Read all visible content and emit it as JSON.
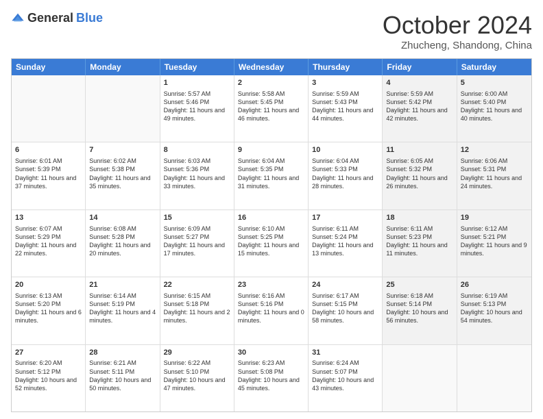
{
  "logo": {
    "general": "General",
    "blue": "Blue"
  },
  "header": {
    "month": "October 2024",
    "location": "Zhucheng, Shandong, China"
  },
  "weekdays": [
    "Sunday",
    "Monday",
    "Tuesday",
    "Wednesday",
    "Thursday",
    "Friday",
    "Saturday"
  ],
  "weeks": [
    [
      {
        "day": "",
        "info": "",
        "shaded": true
      },
      {
        "day": "",
        "info": "",
        "shaded": true
      },
      {
        "day": "1",
        "info": "Sunrise: 5:57 AM\nSunset: 5:46 PM\nDaylight: 11 hours and 49 minutes.",
        "shaded": false
      },
      {
        "day": "2",
        "info": "Sunrise: 5:58 AM\nSunset: 5:45 PM\nDaylight: 11 hours and 46 minutes.",
        "shaded": false
      },
      {
        "day": "3",
        "info": "Sunrise: 5:59 AM\nSunset: 5:43 PM\nDaylight: 11 hours and 44 minutes.",
        "shaded": false
      },
      {
        "day": "4",
        "info": "Sunrise: 5:59 AM\nSunset: 5:42 PM\nDaylight: 11 hours and 42 minutes.",
        "shaded": true
      },
      {
        "day": "5",
        "info": "Sunrise: 6:00 AM\nSunset: 5:40 PM\nDaylight: 11 hours and 40 minutes.",
        "shaded": true
      }
    ],
    [
      {
        "day": "6",
        "info": "Sunrise: 6:01 AM\nSunset: 5:39 PM\nDaylight: 11 hours and 37 minutes.",
        "shaded": false
      },
      {
        "day": "7",
        "info": "Sunrise: 6:02 AM\nSunset: 5:38 PM\nDaylight: 11 hours and 35 minutes.",
        "shaded": false
      },
      {
        "day": "8",
        "info": "Sunrise: 6:03 AM\nSunset: 5:36 PM\nDaylight: 11 hours and 33 minutes.",
        "shaded": false
      },
      {
        "day": "9",
        "info": "Sunrise: 6:04 AM\nSunset: 5:35 PM\nDaylight: 11 hours and 31 minutes.",
        "shaded": false
      },
      {
        "day": "10",
        "info": "Sunrise: 6:04 AM\nSunset: 5:33 PM\nDaylight: 11 hours and 28 minutes.",
        "shaded": false
      },
      {
        "day": "11",
        "info": "Sunrise: 6:05 AM\nSunset: 5:32 PM\nDaylight: 11 hours and 26 minutes.",
        "shaded": true
      },
      {
        "day": "12",
        "info": "Sunrise: 6:06 AM\nSunset: 5:31 PM\nDaylight: 11 hours and 24 minutes.",
        "shaded": true
      }
    ],
    [
      {
        "day": "13",
        "info": "Sunrise: 6:07 AM\nSunset: 5:29 PM\nDaylight: 11 hours and 22 minutes.",
        "shaded": false
      },
      {
        "day": "14",
        "info": "Sunrise: 6:08 AM\nSunset: 5:28 PM\nDaylight: 11 hours and 20 minutes.",
        "shaded": false
      },
      {
        "day": "15",
        "info": "Sunrise: 6:09 AM\nSunset: 5:27 PM\nDaylight: 11 hours and 17 minutes.",
        "shaded": false
      },
      {
        "day": "16",
        "info": "Sunrise: 6:10 AM\nSunset: 5:25 PM\nDaylight: 11 hours and 15 minutes.",
        "shaded": false
      },
      {
        "day": "17",
        "info": "Sunrise: 6:11 AM\nSunset: 5:24 PM\nDaylight: 11 hours and 13 minutes.",
        "shaded": false
      },
      {
        "day": "18",
        "info": "Sunrise: 6:11 AM\nSunset: 5:23 PM\nDaylight: 11 hours and 11 minutes.",
        "shaded": true
      },
      {
        "day": "19",
        "info": "Sunrise: 6:12 AM\nSunset: 5:21 PM\nDaylight: 11 hours and 9 minutes.",
        "shaded": true
      }
    ],
    [
      {
        "day": "20",
        "info": "Sunrise: 6:13 AM\nSunset: 5:20 PM\nDaylight: 11 hours and 6 minutes.",
        "shaded": false
      },
      {
        "day": "21",
        "info": "Sunrise: 6:14 AM\nSunset: 5:19 PM\nDaylight: 11 hours and 4 minutes.",
        "shaded": false
      },
      {
        "day": "22",
        "info": "Sunrise: 6:15 AM\nSunset: 5:18 PM\nDaylight: 11 hours and 2 minutes.",
        "shaded": false
      },
      {
        "day": "23",
        "info": "Sunrise: 6:16 AM\nSunset: 5:16 PM\nDaylight: 11 hours and 0 minutes.",
        "shaded": false
      },
      {
        "day": "24",
        "info": "Sunrise: 6:17 AM\nSunset: 5:15 PM\nDaylight: 10 hours and 58 minutes.",
        "shaded": false
      },
      {
        "day": "25",
        "info": "Sunrise: 6:18 AM\nSunset: 5:14 PM\nDaylight: 10 hours and 56 minutes.",
        "shaded": true
      },
      {
        "day": "26",
        "info": "Sunrise: 6:19 AM\nSunset: 5:13 PM\nDaylight: 10 hours and 54 minutes.",
        "shaded": true
      }
    ],
    [
      {
        "day": "27",
        "info": "Sunrise: 6:20 AM\nSunset: 5:12 PM\nDaylight: 10 hours and 52 minutes.",
        "shaded": false
      },
      {
        "day": "28",
        "info": "Sunrise: 6:21 AM\nSunset: 5:11 PM\nDaylight: 10 hours and 50 minutes.",
        "shaded": false
      },
      {
        "day": "29",
        "info": "Sunrise: 6:22 AM\nSunset: 5:10 PM\nDaylight: 10 hours and 47 minutes.",
        "shaded": false
      },
      {
        "day": "30",
        "info": "Sunrise: 6:23 AM\nSunset: 5:08 PM\nDaylight: 10 hours and 45 minutes.",
        "shaded": false
      },
      {
        "day": "31",
        "info": "Sunrise: 6:24 AM\nSunset: 5:07 PM\nDaylight: 10 hours and 43 minutes.",
        "shaded": false
      },
      {
        "day": "",
        "info": "",
        "shaded": true
      },
      {
        "day": "",
        "info": "",
        "shaded": true
      }
    ]
  ]
}
